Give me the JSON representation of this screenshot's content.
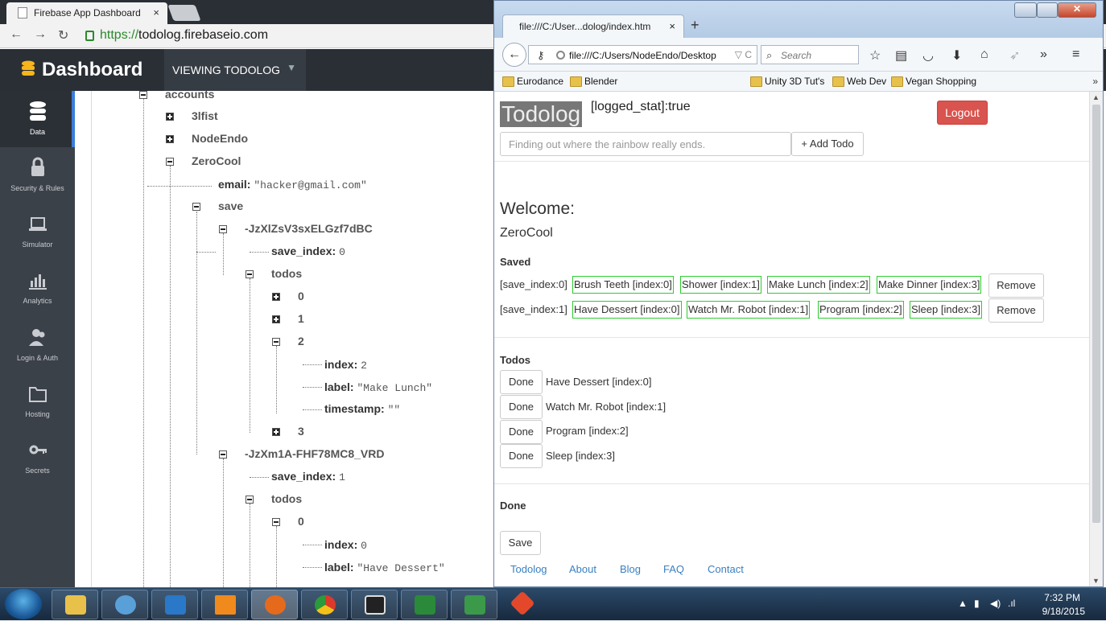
{
  "chrome": {
    "tab_title": "Firebase App Dashboard",
    "tab_close": "×",
    "url_scheme": "https://",
    "url_host": "todolog.firebaseio.com"
  },
  "firebase": {
    "title": "Dashboard",
    "viewing": "VIEWING TODOLOG",
    "sidebar": [
      {
        "label": "Data",
        "icon": "database-icon"
      },
      {
        "label": "Security & Rules",
        "icon": "lock-icon"
      },
      {
        "label": "Simulator",
        "icon": "laptop-icon"
      },
      {
        "label": "Analytics",
        "icon": "bar-chart-icon"
      },
      {
        "label": "Login & Auth",
        "icon": "users-icon"
      },
      {
        "label": "Hosting",
        "icon": "folder-icon"
      },
      {
        "label": "Secrets",
        "icon": "key-icon"
      }
    ],
    "tree": {
      "accounts": "accounts",
      "n_3lfist": "3lfist",
      "n_nodeendo": "NodeEndo",
      "n_zerocool": "ZeroCool",
      "email_key": "email:",
      "email_val": "\"hacker@gmail.com\"",
      "save": "save",
      "save1_id": "-JzXlZsV3sxELGzf7dBC",
      "save_index_key": "save_index:",
      "save1_index_val": "0",
      "todos": "todos",
      "t0": "0",
      "t1": "1",
      "t2": "2",
      "index_key": "index:",
      "t2_index_val": "2",
      "label_key": "label:",
      "t2_label_val": "\"Make Lunch\"",
      "timestamp_key": "timestamp:",
      "t2_timestamp_val": "\"\"",
      "t3": "3",
      "save2_id": "-JzXm1A-FHF78MC8_VRD",
      "save2_index_val": "1",
      "s2_t0": "0",
      "s2_t0_index_val": "0",
      "s2_t0_label_val": "\"Have Dessert\""
    }
  },
  "firefox": {
    "tab_title": "file:///C:/User...dolog/index.htm",
    "tab_close": "×",
    "new_tab": "+",
    "url": "file:///C:/Users/NodeEndo/Desktop",
    "search_placeholder": "Search",
    "bookmarks": [
      "Eurodance",
      "Blender",
      "Unity 3D Tut's",
      "Web Dev",
      "Vegan Shopping"
    ],
    "bookmarks_more": "»"
  },
  "page": {
    "brand": "Todolog",
    "logged_stat": "[logged_stat]:true",
    "logout": "Logout",
    "todo_input_placeholder": "Finding out where the rainbow really ends.",
    "add_todo": "+ Add Todo",
    "welcome": "Welcome:",
    "username": "ZeroCool",
    "saved_heading": "Saved",
    "saves": [
      {
        "label": "[save_index:0]",
        "items": [
          "Brush Teeth [index:0]",
          "Shower [index:1]",
          "Make Lunch [index:2]",
          "Make Dinner [index:3]"
        ]
      },
      {
        "label": "[save_index:1]",
        "items": [
          "Have Dessert [index:0]",
          "Watch Mr. Robot [index:1]",
          "Program [index:2]",
          "Sleep [index:3]"
        ]
      }
    ],
    "remove": "Remove",
    "todos_heading": "Todos",
    "done_button": "Done",
    "todos": [
      "Have Dessert [index:0]",
      "Watch Mr. Robot [index:1]",
      "Program [index:2]",
      "Sleep [index:3]"
    ],
    "done_heading": "Done",
    "save_button": "Save",
    "footer": [
      "Todolog",
      "About",
      "Blog",
      "FAQ",
      "Contact"
    ]
  },
  "taskbar": {
    "time": "7:32 PM",
    "date": "9/18/2015"
  }
}
